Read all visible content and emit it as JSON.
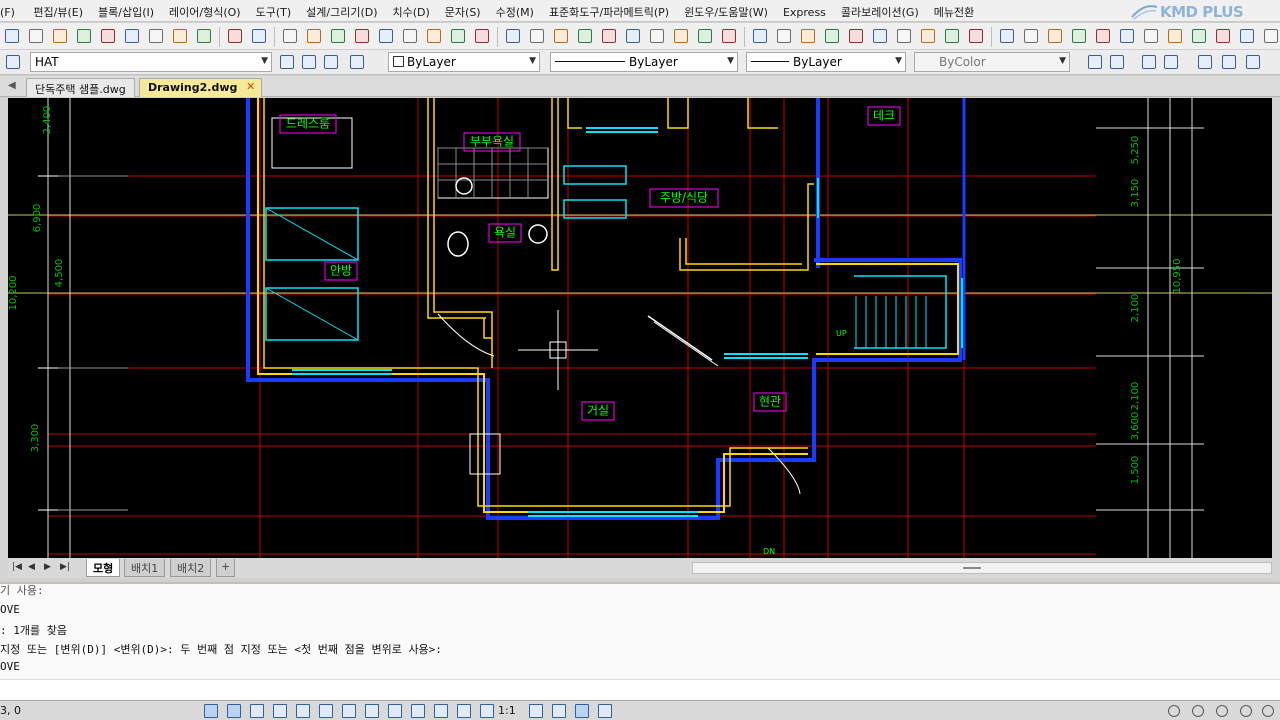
{
  "menu": [
    "편집/뷰(E)",
    "블록/삽입(I)",
    "레이어/형식(O)",
    "도구(T)",
    "설계/그리기(D)",
    "치수(D)",
    "문자(S)",
    "수정(M)",
    "표준화도구/파라메트릭(P)",
    "윈도우/도움말(W)",
    "Express",
    "콜라보레이션(G)",
    "메뉴전환"
  ],
  "menu_first": "(F)",
  "brand": "KMD PLUS",
  "properties": {
    "layer": "HAT",
    "color": "ByLayer",
    "linetype": "ByLayer",
    "lineweight": "ByLayer",
    "plotstyle": "ByColor"
  },
  "file_tabs": [
    "단독주택 샘플.dwg",
    "Drawing2.dwg"
  ],
  "layout_tabs": [
    "모형",
    "배치1",
    "배치2",
    "+"
  ],
  "drawing": {
    "room_labels": [
      "드레스룸",
      "부부욕실",
      "주방/식당",
      "데크",
      "욕실",
      "안방",
      "거실",
      "현관"
    ],
    "dimensions_left": [
      "2,400",
      "6,900",
      "4,500",
      "10,200",
      "3,300"
    ],
    "dimensions_right": [
      "5,250",
      "3,150",
      "10,950",
      "2,100",
      "2,100",
      "3,600",
      "1,500"
    ],
    "labels_up": "UP",
    "labels_dn": "DN"
  },
  "command": {
    "lines": [
      "OVE",
      ": 1개를 찾음",
      "지정 또는 [변위(D)] <변위(D)>: 두 번째 점 지정 또는 <첫 번째 점을 변위로 사용>:",
      "OVE"
    ],
    "partial": "기 사용:"
  },
  "status": {
    "coords": "3, 0",
    "scale": "1:1"
  },
  "colors": {
    "background": "#000000",
    "wall": "#ffd700",
    "window": "#00e5ff",
    "grid": "#c00000",
    "dimension": "#00c000",
    "room_label": "#00ff00",
    "label_box": "#ff00ff"
  }
}
